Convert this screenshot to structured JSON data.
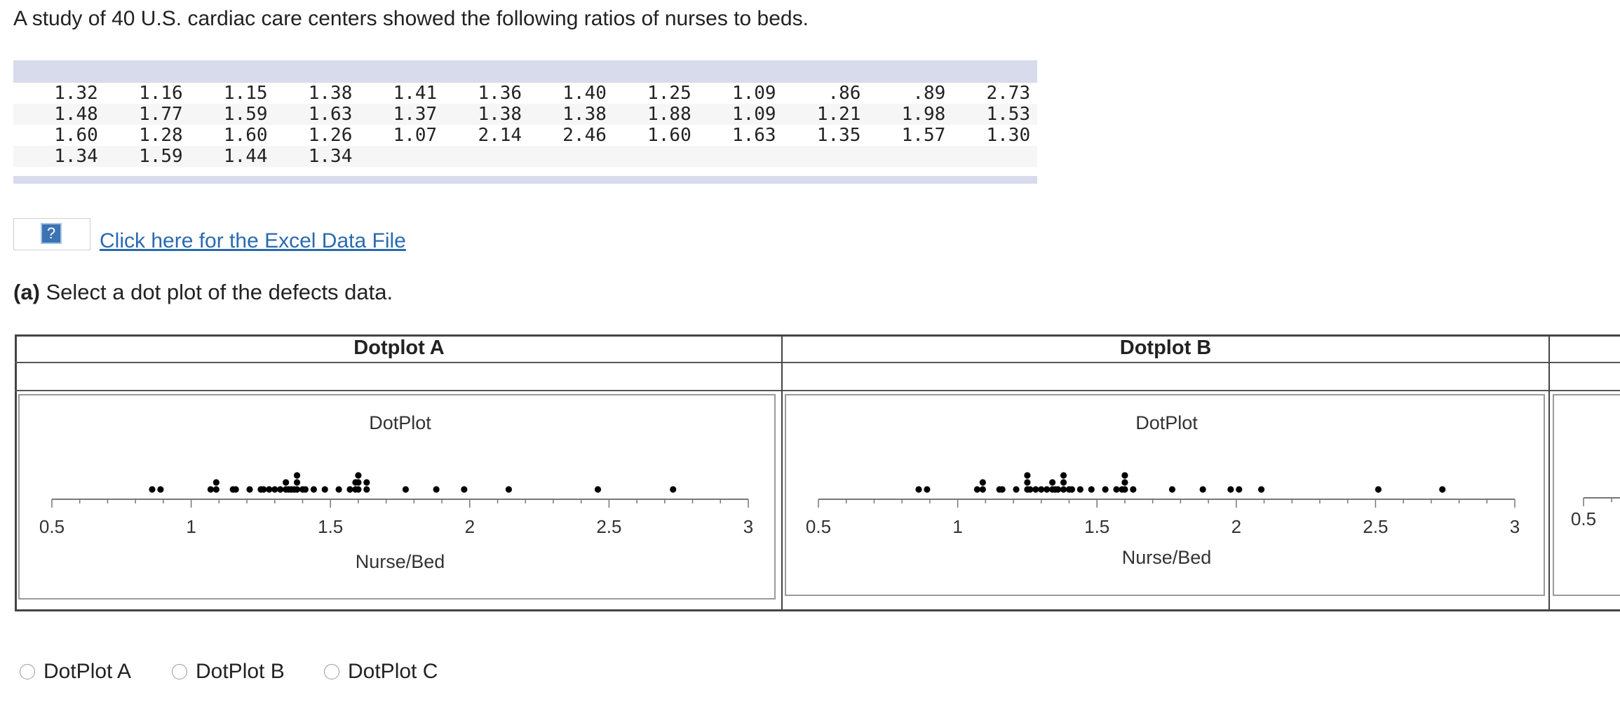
{
  "intro_text": "A study of 40 U.S. cardiac care centers showed the following ratios of nurses to beds.",
  "data_table": {
    "rows": [
      [
        "1.32",
        "1.16",
        "1.15",
        "1.38",
        "1.41",
        "1.36",
        "1.40",
        "1.25",
        "1.09",
        ".86",
        ".89",
        "2.73"
      ],
      [
        "1.48",
        "1.77",
        "1.59",
        "1.63",
        "1.37",
        "1.38",
        "1.38",
        "1.88",
        "1.09",
        "1.21",
        "1.98",
        "1.53"
      ],
      [
        "1.60",
        "1.28",
        "1.60",
        "1.26",
        "1.07",
        "2.14",
        "2.46",
        "1.60",
        "1.63",
        "1.35",
        "1.57",
        "1.30"
      ],
      [
        "1.34",
        "1.59",
        "1.44",
        "1.34",
        "",
        "",
        "",
        "",
        "",
        "",
        "",
        ""
      ]
    ]
  },
  "excel": {
    "icon": "help-question-icon",
    "icon_glyph": "?",
    "link_text": "Click here for the Excel Data File"
  },
  "question": {
    "prefix": "(a)",
    "text": " Select a dot plot of the defects data."
  },
  "plots": [
    {
      "header": "Dotplot A",
      "chart_data": {
        "type": "scatter",
        "title": "DotPlot",
        "xlabel": "Nurse/Bed",
        "xlim": [
          0.5,
          3
        ],
        "ticks": [
          "0.5",
          "1",
          "1.5",
          "2",
          "2.5",
          "3"
        ],
        "points": [
          0.86,
          0.89,
          1.07,
          1.09,
          1.09,
          1.15,
          1.16,
          1.21,
          1.25,
          1.26,
          1.28,
          1.3,
          1.32,
          1.34,
          1.34,
          1.35,
          1.36,
          1.37,
          1.38,
          1.38,
          1.38,
          1.4,
          1.41,
          1.44,
          1.48,
          1.53,
          1.57,
          1.59,
          1.59,
          1.6,
          1.6,
          1.6,
          1.63,
          1.63,
          1.77,
          1.88,
          1.98,
          2.14,
          2.46,
          2.73
        ]
      }
    },
    {
      "header": "Dotplot B",
      "chart_data": {
        "type": "scatter",
        "title": "DotPlot",
        "xlabel": "Nurse/Bed",
        "xlim": [
          0.5,
          3
        ],
        "ticks": [
          "0.5",
          "1",
          "1.5",
          "2",
          "2.5",
          "3"
        ],
        "points": [
          0.86,
          0.89,
          1.07,
          1.09,
          1.09,
          1.15,
          1.16,
          1.21,
          1.25,
          1.25,
          1.25,
          1.26,
          1.28,
          1.3,
          1.32,
          1.34,
          1.34,
          1.35,
          1.36,
          1.38,
          1.38,
          1.38,
          1.4,
          1.41,
          1.44,
          1.48,
          1.53,
          1.57,
          1.59,
          1.6,
          1.6,
          1.6,
          1.63,
          1.77,
          1.88,
          1.98,
          2.01,
          2.09,
          2.51,
          2.74
        ]
      }
    },
    {
      "header": "",
      "chart_data": {
        "type": "scatter",
        "ticks": [
          "0.5"
        ]
      }
    }
  ],
  "options": [
    {
      "label": "DotPlot A"
    },
    {
      "label": "DotPlot B"
    },
    {
      "label": "DotPlot C"
    }
  ]
}
